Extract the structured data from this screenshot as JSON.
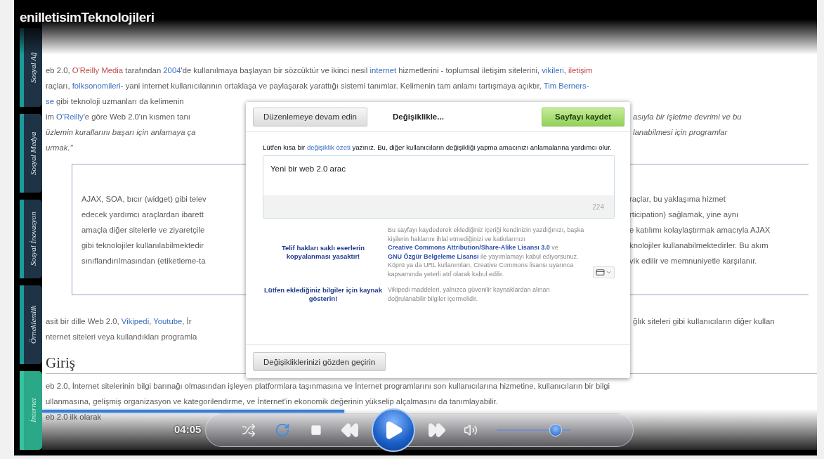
{
  "video_title": "enilletisimTeknolojileri",
  "sidebar_tabs": [
    {
      "label": "Sosyal Ağ",
      "selected": false
    },
    {
      "label": "Sosyal Medya",
      "selected": false
    },
    {
      "label": "Sosyal İnovasyon",
      "selected": false
    },
    {
      "label": "Örneklemlik",
      "selected": false
    },
    {
      "label": "İnternet",
      "selected": true
    }
  ],
  "article": {
    "intro_rows": [
      {
        "fragments": [
          {
            "italic": false,
            "segments": [
              {
                "kind": "text",
                "text": "eb 2.0, "
              },
              {
                "kind": "red",
                "text": "O'Reilly Media"
              },
              {
                "kind": "text",
                "text": " tarafından "
              },
              {
                "kind": "link",
                "text": "2004"
              },
              {
                "kind": "text",
                "text": "'de kullanılmaya başlayan bir sözcüktür ve ikinci nesil "
              },
              {
                "kind": "link",
                "text": "internet"
              },
              {
                "kind": "text",
                "text": " hizmetlerini - toplumsal iletişim sitelerini, "
              },
              {
                "kind": "link",
                "text": "vikileri"
              },
              {
                "kind": "text",
                "text": ", "
              },
              {
                "kind": "red",
                "text": "iletişim"
              }
            ]
          }
        ]
      },
      {
        "fragments": [
          {
            "italic": false,
            "segments": [
              {
                "kind": "text",
                "text": "raçları, "
              },
              {
                "kind": "link",
                "text": "folksonomileri"
              },
              {
                "kind": "text",
                "text": "- yani internet kullanıcılarının ortaklaşa ve paylaşarak yarattığı sistemi tanımlar. Kelimenin tam anlamı tartışmaya açıktır, "
              },
              {
                "kind": "link",
                "text": "Tim Berners-"
              }
            ]
          }
        ]
      },
      {
        "fragments": [
          {
            "italic": false,
            "segments": [
              {
                "kind": "link",
                "text": "se"
              },
              {
                "kind": "text",
                "text": " gibi teknoloji uzmanları da kelimenin"
              }
            ]
          }
        ]
      },
      {
        "fragments": [
          {
            "italic": false,
            "segments": [
              {
                "kind": "text",
                "text": "im "
              },
              {
                "kind": "link",
                "text": "O'Reilly"
              },
              {
                "kind": "text",
                "text": "'e göre Web 2.0'ın kısmen tanı"
              }
            ]
          },
          {
            "italic": true,
            "segments": [
              {
                "kind": "text",
                "text": "asıyla bir işletme devrimi ve bu"
              }
            ]
          }
        ]
      },
      {
        "fragments": [
          {
            "italic": true,
            "segments": [
              {
                "kind": "text",
                "text": "üzlemin kurallarını başarı için anlamaya ça"
              }
            ]
          },
          {
            "italic": true,
            "segments": [
              {
                "kind": "text",
                "text": "lanabilmesi için programlar"
              }
            ]
          }
        ]
      },
      {
        "fragments": [
          {
            "italic": true,
            "segments": [
              {
                "kind": "text",
                "text": "urmak.\""
              }
            ]
          }
        ]
      }
    ],
    "quote_rows": [
      {
        "fragments": [
          {
            "italic": false,
            "segments": [
              {
                "kind": "text",
                "text": "AJAX, SOA, bıcır (widget) gibi telev"
              }
            ]
          },
          {
            "italic": false,
            "segments": [
              {
                "kind": "text",
                "text": "raçlar, bu yaklaşıma hizmet"
              }
            ]
          }
        ]
      },
      {
        "fragments": [
          {
            "italic": false,
            "segments": [
              {
                "kind": "text",
                "text": "edecek yardımcı araçlardan ibarett"
              }
            ]
          },
          {
            "italic": false,
            "segments": [
              {
                "kind": "text",
                "text": "rticipation) sağlamak, yine aynı"
              }
            ]
          }
        ]
      },
      {
        "fragments": [
          {
            "italic": false,
            "segments": [
              {
                "kind": "text",
                "text": "amaçla diğer sitelerle ve ziyaretçile"
              }
            ]
          },
          {
            "italic": false,
            "segments": [
              {
                "kind": "text",
                "text": "e katılımı kolaylaştırmak amacıyla AJAX"
              }
            ]
          }
        ]
      },
      {
        "fragments": [
          {
            "italic": false,
            "segments": [
              {
                "kind": "text",
                "text": "gibi teknolojiler kullanılabilmektedir"
              }
            ]
          },
          {
            "italic": false,
            "segments": [
              {
                "kind": "text",
                "text": "knolojiler kullanabilmektedirler. Bu akım"
              }
            ]
          }
        ]
      },
      {
        "fragments": [
          {
            "italic": false,
            "segments": [
              {
                "kind": "text",
                "text": "sınıflandırılmasından (etiketleme-ta"
              }
            ]
          },
          {
            "italic": false,
            "segments": [
              {
                "kind": "text",
                "text": "vik edilir ve memnuniyetle karşılanır."
              }
            ]
          }
        ]
      }
    ],
    "after_rows": [
      {
        "fragments": [
          {
            "italic": false,
            "segments": [
              {
                "kind": "text",
                "text": "asit bir dille Web 2.0, "
              },
              {
                "kind": "link",
                "text": "Vikipedi"
              },
              {
                "kind": "text",
                "text": ", "
              },
              {
                "kind": "link",
                "text": "Youtube"
              },
              {
                "kind": "text",
                "text": ", İr"
              }
            ]
          },
          {
            "italic": false,
            "segments": [
              {
                "kind": "text",
                "text": "ğlık siteleri gibi kullanıcıların diğer kullan"
              }
            ]
          }
        ]
      },
      {
        "fragments": [
          {
            "italic": false,
            "segments": [
              {
                "kind": "text",
                "text": "nternet siteleri veya kullandıkları programla"
              }
            ]
          }
        ]
      }
    ],
    "heading": "Giriş",
    "section_rows": [
      {
        "fragments": [
          {
            "italic": false,
            "segments": [
              {
                "kind": "text",
                "text": "eb 2.0, İnternet sitelerinin bilgi barınağı olmasından işleyen platformlara taşınmasına ve İnternet programlarını son kullanıcılarına hizmetine, kullanıcıların bir bilgi"
              }
            ]
          }
        ]
      },
      {
        "fragments": [
          {
            "italic": false,
            "segments": [
              {
                "kind": "text",
                "text": "ullanmasına, gelişmiş organizasyon ve kategorilendirme, ve İnternet'in ekonomik değerinin yükselip alçalmasını da tanımlayabilir."
              }
            ]
          }
        ]
      },
      {
        "fragments": [
          {
            "italic": false,
            "segments": [
              {
                "kind": "text",
                "text": "eb 2.0 ilk olarak"
              }
            ]
          }
        ]
      }
    ]
  },
  "save_dialog": {
    "continue_button": "Düzenlemeye devam edin",
    "status": "Değişiklikle...",
    "save_button": "Sayfayı kaydet",
    "summary_prompt": [
      {
        "kind": "text",
        "text": "Lütfen kısa bir "
      },
      {
        "kind": "link",
        "text": "değişiklik özeti"
      },
      {
        "kind": "text",
        "text": " yazınız. Bu, diğer kullanıcıların değişikliği yapma amacınızı anlamalarına yardımcı olur."
      }
    ],
    "summary_value": "Yeni bir web 2.0 arac",
    "char_count": "224",
    "notices": [
      {
        "warning": "Telif hakları saklı eserlerin kopyalanması yasaktır!",
        "segments": [
          {
            "kind": "text",
            "text": "Bu sayfayı kaydederek eklediğiniz içeriği kendinizin yazdığınızı, başka kişilerin haklarını ihlal etmediğinizi ve katkılarınızı "
          },
          {
            "kind": "link",
            "text": "Creative Commons Attribution/Share-Alike Lisansı 3.0"
          },
          {
            "kind": "text",
            "text": " ve "
          },
          {
            "kind": "link",
            "text": "GNU Özgür Belgeleme Lisansı"
          },
          {
            "kind": "text",
            "text": " ile yayımlamayı kabul ediyorsunuz. Köprü ya da URL kullanımları, Creative Commons lisansı uyarınca kapsamında yeterli atıf olarak kabul edilir."
          }
        ]
      },
      {
        "warning": "Lütfen eklediğiniz bilgiler için kaynak gösterin!",
        "segments": [
          {
            "kind": "text",
            "text": "Vikipedi maddeleri, yalnızca güvenilir kaynaklardan alınan doğrulanabilir bilgiler içermelidir."
          }
        ]
      }
    ],
    "review_button": "Değişikliklerinizi gözden geçirin"
  },
  "player": {
    "time": "04:05",
    "seek": {
      "level": 0.39
    },
    "volume": {
      "level": 0.8
    }
  }
}
